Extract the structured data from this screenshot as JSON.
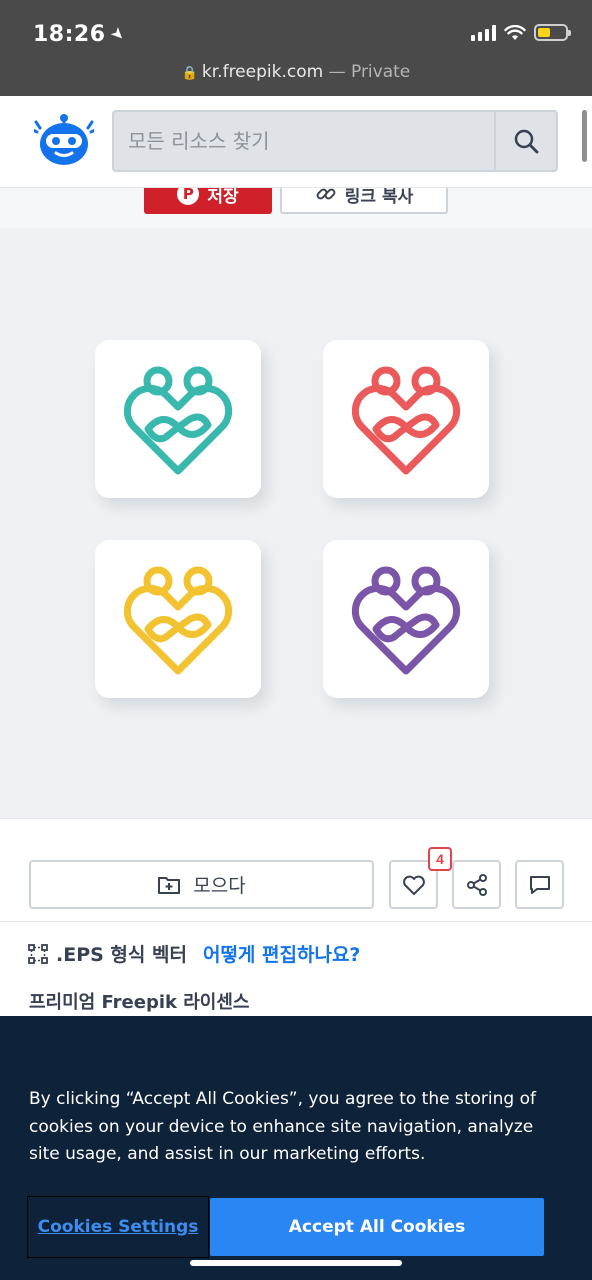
{
  "status_bar": {
    "time": "18:26",
    "location_icon": "location-arrow-icon",
    "icons": [
      "cellular-signal-icon",
      "wifi-icon",
      "battery-icon"
    ]
  },
  "url_bar": {
    "domain": "kr.freepik.com",
    "mode": " — Private"
  },
  "header": {
    "logo_icon": "freepik-robot-logo",
    "search": {
      "placeholder": "모든 리소스 찾기",
      "value": ""
    },
    "search_icon": "search-icon"
  },
  "share": {
    "pinterest_label": "저장",
    "copy_link_label": "링크 복사"
  },
  "preview": {
    "tiles": [
      {
        "name": "teal-heart-logo",
        "color": "#39b8ae"
      },
      {
        "name": "red-heart-logo",
        "color": "#ea5a5a"
      },
      {
        "name": "yellow-heart-logo",
        "color": "#f2c230"
      },
      {
        "name": "purple-heart-logo",
        "color": "#7b55a8"
      }
    ]
  },
  "actions": {
    "collect_label": "모으다",
    "like_count": "4",
    "icons": [
      "folder-plus-icon",
      "heart-icon",
      "share-icon",
      "comment-icon"
    ]
  },
  "info": {
    "format_label": ".EPS 형식 벡터",
    "edit_link": "어떻게 편집하나요?",
    "license": "프리미엄 Freepik 라이센스"
  },
  "cookie_banner": {
    "text": "By clicking “Accept All Cookies”, you agree to the storing of cookies on your device to enhance site navigation, analyze site usage, and assist in our marketing efforts.",
    "settings_label": "Cookies Settings",
    "accept_label": "Accept All Cookies"
  },
  "colors": {
    "accent": "#2a86f2",
    "banner": "#0e2239",
    "pinterest": "#d0202a"
  }
}
